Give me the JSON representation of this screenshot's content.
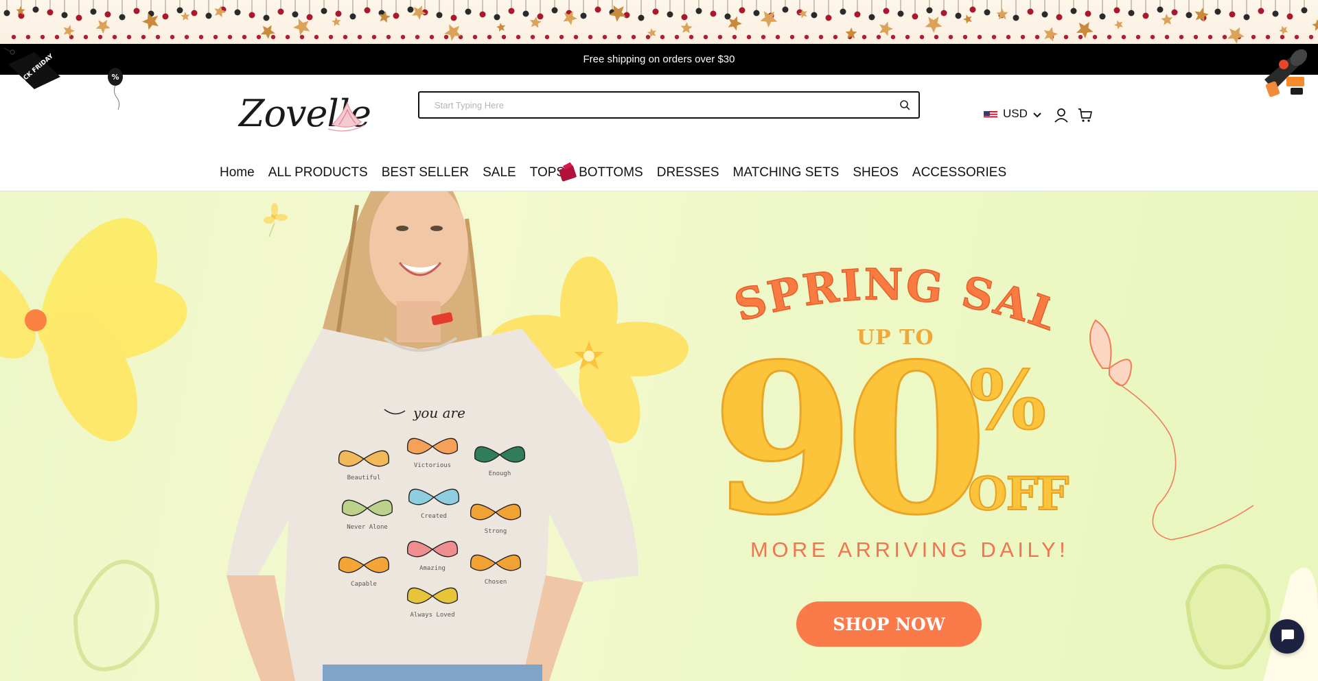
{
  "announcement": {
    "text": "Free shipping on orders over $30"
  },
  "decor": {
    "black_friday_tag": "BLACK FRIDAY",
    "balloon_label": "%"
  },
  "brand": {
    "name": "Zovelle"
  },
  "search": {
    "placeholder": "Start Typing Here",
    "value": ""
  },
  "header": {
    "currency": "USD"
  },
  "nav": {
    "items": [
      "Home",
      "ALL PRODUCTS",
      "BEST SELLER",
      "SALE",
      "TOPS",
      "BOTTOMS",
      "DRESSES",
      "MATCHING SETS",
      "SHEOS",
      "ACCESSORIES"
    ]
  },
  "hero": {
    "headline": "SPRING SALE",
    "up_to": "UP TO",
    "discount_number": "90",
    "percent_sign": "%",
    "off": "OFF",
    "subline": "MORE ARRIVING DAILY!",
    "cta": "SHOP NOW",
    "shirt_lettering": "you are",
    "butterfly_words": [
      "Beautiful",
      "Victorious",
      "Enough",
      "Never Alone",
      "Created",
      "Strong",
      "Capable",
      "Amazing",
      "Chosen",
      "Always Loved"
    ]
  },
  "colors": {
    "accent_orange": "#fb7a4a",
    "accent_yellow": "#fbc43b",
    "announcement_bg": "#000000",
    "chat_button": "#1c2240"
  }
}
